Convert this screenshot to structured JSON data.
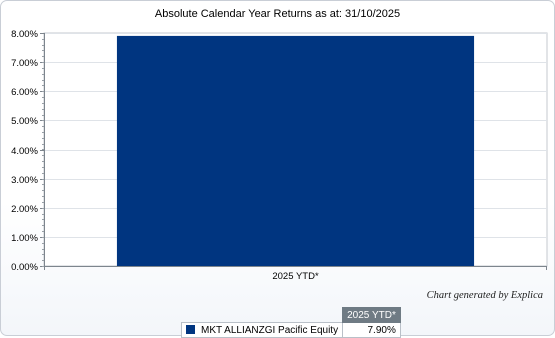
{
  "chart_data": {
    "type": "bar",
    "title": "Absolute Calendar Year Returns as at: 31/10/2025",
    "categories": [
      "2025 YTD*"
    ],
    "series": [
      {
        "name": "MKT ALLIANZGI Pacific Equity",
        "values": [
          7.9
        ],
        "color": "#003580"
      }
    ],
    "ylim": [
      0,
      8
    ],
    "yticks": [
      0,
      1,
      2,
      3,
      4,
      5,
      6,
      7,
      8
    ],
    "ytick_labels": [
      "0.00%",
      "1.00%",
      "2.00%",
      "3.00%",
      "4.00%",
      "5.00%",
      "6.00%",
      "7.00%",
      "8.00%"
    ],
    "grid": true,
    "legend_position": "bottom-center"
  },
  "credit": "Chart generated by Explica",
  "legend_table": {
    "column_header": "2025 YTD*",
    "rows": [
      {
        "label": "MKT ALLIANZGI Pacific Equity",
        "value": "7.90%",
        "color": "#003580"
      }
    ]
  }
}
